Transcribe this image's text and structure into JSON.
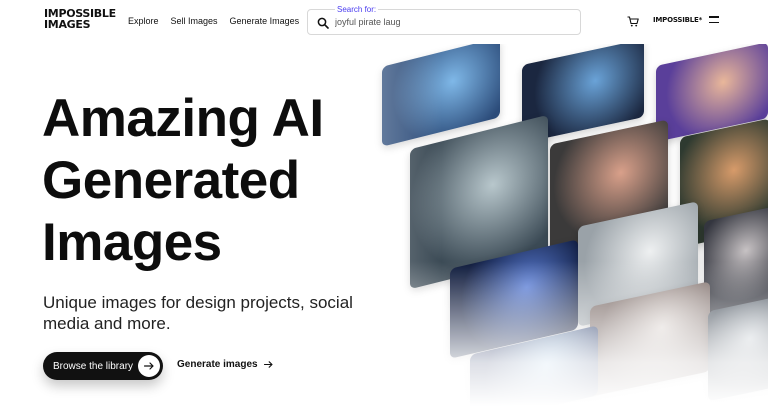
{
  "header": {
    "logo_lines": [
      "IMPOSSIBLE",
      "IMAGES"
    ],
    "nav": [
      "Explore",
      "Sell Images",
      "Generate Images"
    ],
    "search": {
      "label": "Search for:",
      "value": "joyful pirate laug"
    },
    "small_logo": "IMPOSSIBLE*"
  },
  "hero": {
    "title_lines": [
      "Amazing AI",
      "Generated",
      "Images"
    ],
    "subtitle": "Unique images for design projects, social media and more.",
    "primary_button": "Browse the library",
    "secondary_button": "Generate images"
  },
  "mosaic": {
    "tiles": [
      {
        "name": "tile-vr-pod",
        "colors": [
          "#2c4c7a",
          "#7fb8e8"
        ]
      },
      {
        "name": "tile-futuristic-crowd",
        "colors": [
          "#1b2740",
          "#6aa3d8"
        ]
      },
      {
        "name": "tile-vr-headset",
        "colors": [
          "#5a3f9a",
          "#e9b79a"
        ]
      },
      {
        "name": "tile-glowing-cube",
        "colors": [
          "#3b4a55",
          "#b8c7cc"
        ]
      },
      {
        "name": "tile-sunset-park",
        "colors": [
          "#3b3a3a",
          "#d9a08a"
        ]
      },
      {
        "name": "tile-plant-room",
        "colors": [
          "#2e3a30",
          "#d79b6a"
        ]
      },
      {
        "name": "tile-neon-hall",
        "colors": [
          "#0e1a3c",
          "#5c7fd6"
        ]
      },
      {
        "name": "tile-white-interior",
        "colors": [
          "#9aa2a8",
          "#eef0f1"
        ]
      },
      {
        "name": "tile-crowd-portraits",
        "colors": [
          "#34363f",
          "#c7c2c4"
        ]
      },
      {
        "name": "tile-gallery",
        "colors": [
          "#7a6a66",
          "#dcd4d0"
        ]
      },
      {
        "name": "tile-neon-street",
        "colors": [
          "#1a2a5a",
          "#a8cbe8"
        ]
      },
      {
        "name": "tile-city-fog",
        "colors": [
          "#4c5560",
          "#c8ced4"
        ]
      }
    ]
  }
}
